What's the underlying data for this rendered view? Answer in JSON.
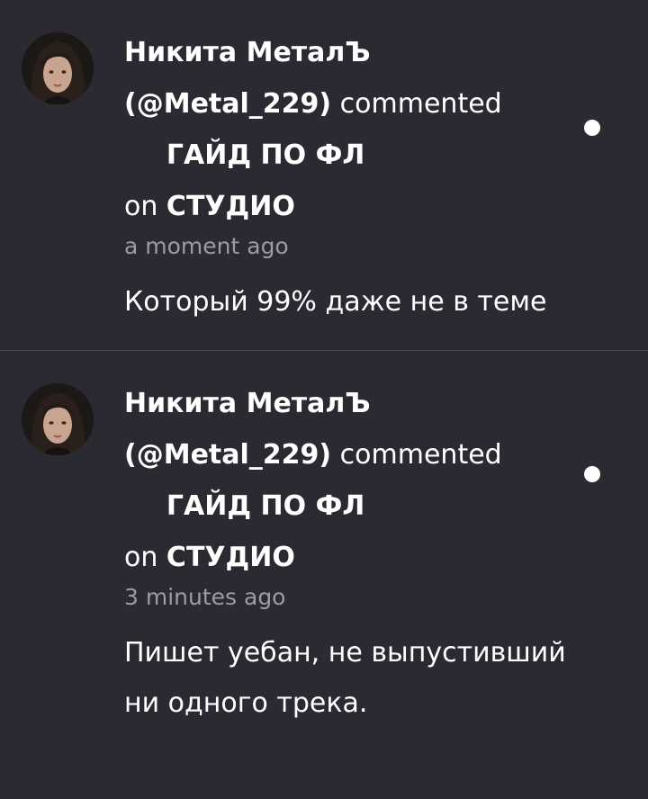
{
  "notifications": [
    {
      "author": "Никита МеталЪ",
      "handle": "(@Metal_229)",
      "action": "commented",
      "preposition": "on",
      "post_title": "ГАЙД ПО ФЛ СТУДИО",
      "time": "a moment ago",
      "comment": "Который 99% даже не в теме",
      "unread": true
    },
    {
      "author": "Никита МеталЪ",
      "handle": "(@Metal_229)",
      "action": "commented",
      "preposition": "on",
      "post_title": "ГАЙД ПО ФЛ СТУДИО",
      "time": "3 minutes ago",
      "comment": "Пишет уебан, не выпустивший ни одного трека.",
      "unread": true
    }
  ],
  "colors": {
    "background": "#2b2a33",
    "text": "#ffffff",
    "muted": "#9c9aa3",
    "divider": "#4a4952"
  }
}
